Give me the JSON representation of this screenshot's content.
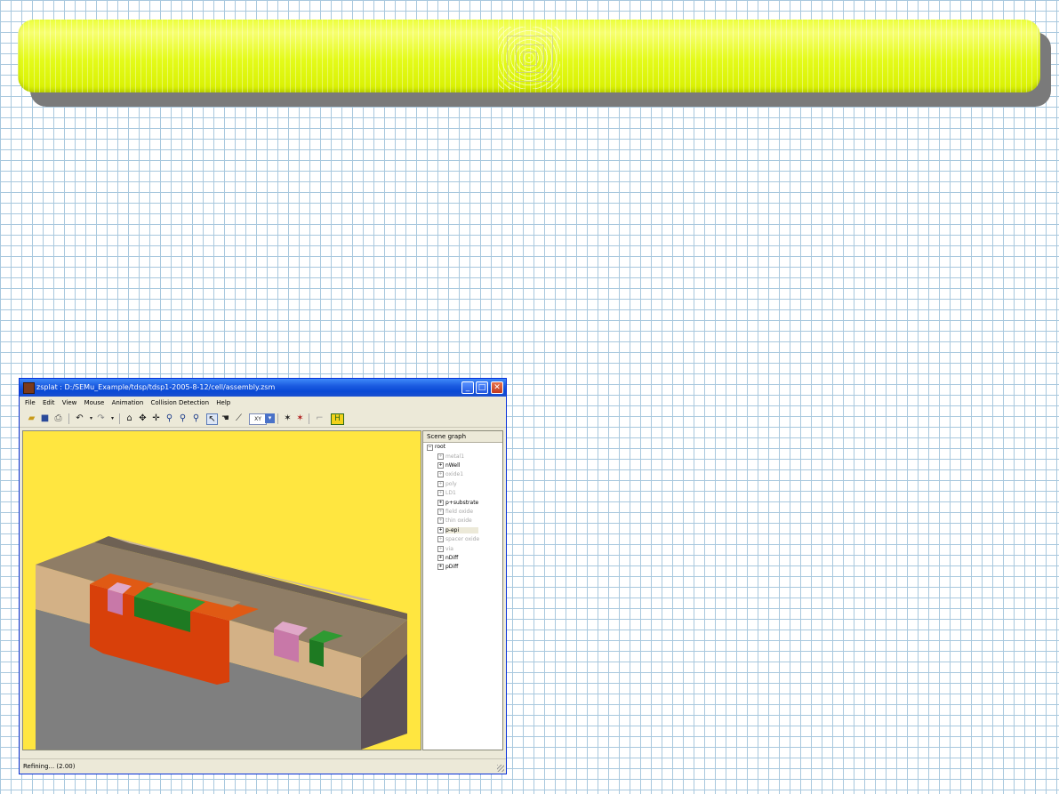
{
  "banner": {
    "colors": {
      "fill": "#e8ff20",
      "shadow": "#7a7a7a"
    }
  },
  "window": {
    "title": "zsplat : D:/SEMu_Example/tdsp/tdsp1-2005-8-12/cell/assembly.zsm",
    "controls": {
      "minimize": "_",
      "maximize": "□",
      "close": "✕"
    }
  },
  "menu": [
    "File",
    "Edit",
    "View",
    "Mouse",
    "Animation",
    "Collision Detection",
    "Help"
  ],
  "toolbar": {
    "view_select": "XY",
    "icons": [
      "open-icon",
      "save-icon",
      "print-icon",
      "undo-icon",
      "redo-icon",
      "home-icon",
      "rotate-icon",
      "pan-icon",
      "zoom-icon",
      "zoom-out-icon",
      "zoom-fit-icon",
      "select-icon",
      "hand-icon",
      "measure-icon",
      "run-icon",
      "collision-icon",
      "export-icon"
    ]
  },
  "scene_graph": {
    "header": "Scene graph",
    "root": "root",
    "items": [
      {
        "label": "metal1",
        "visible": false
      },
      {
        "label": "nWell",
        "visible": true
      },
      {
        "label": "oxide1",
        "visible": false
      },
      {
        "label": "poly",
        "visible": false
      },
      {
        "label": "LD1",
        "visible": false
      },
      {
        "label": "p+substrate",
        "visible": true
      },
      {
        "label": "field oxide",
        "visible": false
      },
      {
        "label": "thin oxide",
        "visible": false
      },
      {
        "label": "p-epi",
        "visible": true,
        "selected": true
      },
      {
        "label": "spacer oxide",
        "visible": false
      },
      {
        "label": "via",
        "visible": false
      },
      {
        "label": "nDiff",
        "visible": true
      },
      {
        "label": "pDiff",
        "visible": true
      }
    ]
  },
  "viewport": {
    "background": "#ffe640"
  },
  "status": {
    "text": "Refining... (2.00)"
  }
}
